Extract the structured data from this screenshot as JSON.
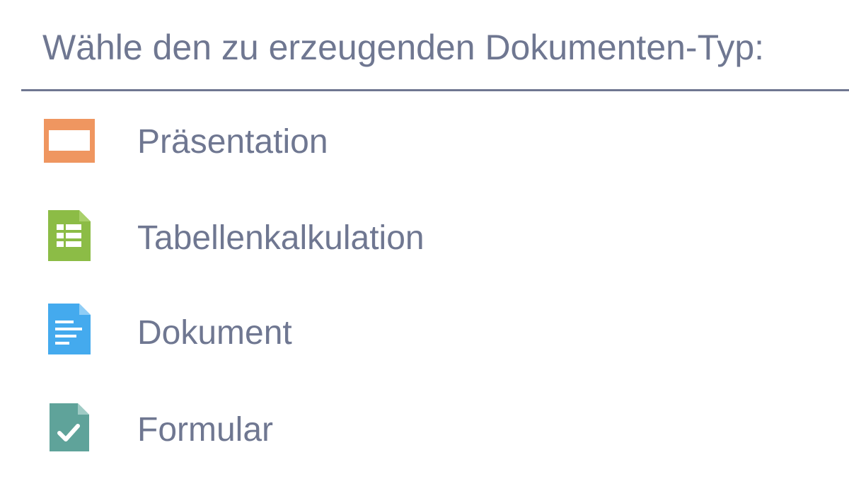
{
  "dialog": {
    "title": "Wähle den zu erzeugenden Dokumenten-Typ:",
    "items": [
      {
        "label": "Präsentation",
        "icon": "presentation-icon",
        "color": "#ef9660"
      },
      {
        "label": "Tabellenkalkulation",
        "icon": "spreadsheet-icon",
        "color": "#8cbc46"
      },
      {
        "label": "Dokument",
        "icon": "document-icon",
        "color": "#44aaee"
      },
      {
        "label": "Formular",
        "icon": "form-icon",
        "color": "#5fa39a"
      }
    ]
  }
}
